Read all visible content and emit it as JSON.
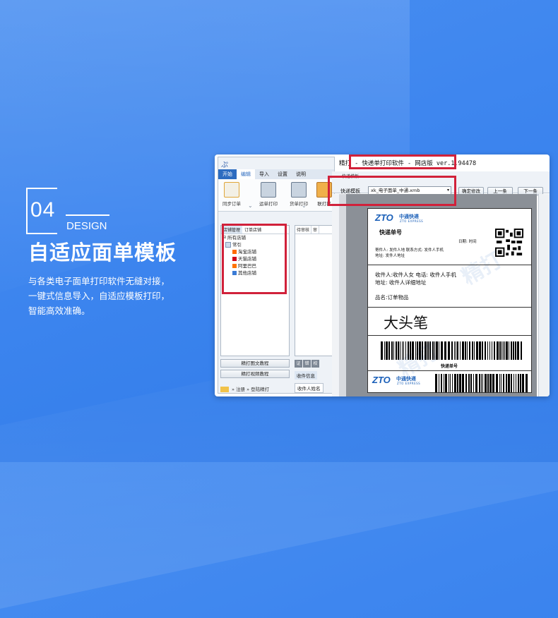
{
  "heading": {
    "number": "04",
    "word": "DESIGN",
    "title": "自适应面单模板",
    "desc_lines": [
      "与各类电子面单打印软件无缝对接，",
      "一键式信息导入，自适应模板打印，",
      "智能高效准确。"
    ]
  },
  "app": {
    "logo": "ぷ",
    "tabs": [
      "开始",
      "编辑",
      "导入",
      "设置",
      "说明"
    ],
    "ribbon_buttons": [
      "同步订单",
      "运单打印",
      "货单打印",
      "联打打"
    ],
    "tree_tabs": [
      "店铺管理",
      "订单店铺"
    ],
    "tree": [
      "所有店铺",
      "常引",
      "淘宝店铺",
      "天猫店铺",
      "阿里巴巴",
      "其他店铺"
    ],
    "col2_headers": [
      "待审核",
      "审"
    ],
    "col2_right": [
      "打",
      "您",
      "作",
      "作",
      "仔"
    ],
    "buttons": [
      "精打图文教程",
      "精打视频教程"
    ],
    "dark_tabs": [
      "证",
      "错",
      "校"
    ],
    "info_tab": "收件信息",
    "info_row": "收件人姓名",
    "footer": "» 注册  » 登陆精打"
  },
  "print_window": {
    "title": "精打 - 快递单打印软件 - 网店版",
    "version": "ver.1.94478",
    "small_label": "快递模板",
    "template_label": "快递模板",
    "template_value": "xk_电子面单_中通.xmb",
    "buttons": [
      "确定修改",
      "上一条",
      "下一条"
    ]
  },
  "waybill": {
    "brand_text": "ZTO",
    "brand_cn": "中通快递",
    "brand_en": "ZTO EXPRESS",
    "tracking_label": "快递单号",
    "sender": "寄件人: 发件人地 联系方式: 发件人手机",
    "sender_addr": "地址: 发件人地址",
    "date": "日期: 时间",
    "receiver": "收件人:收件人女 电话: 收件人手机",
    "receiver_addr": "地址: 收件人详细地址",
    "goods_label": "品名:订单物品",
    "goods": "大头笔",
    "barcode_caption": "快递单号",
    "watermark": "精打"
  },
  "colors": {
    "accent_red": "#d1213a",
    "zto_blue": "#1a5fb8",
    "bg_blue": "#3e86ef"
  }
}
